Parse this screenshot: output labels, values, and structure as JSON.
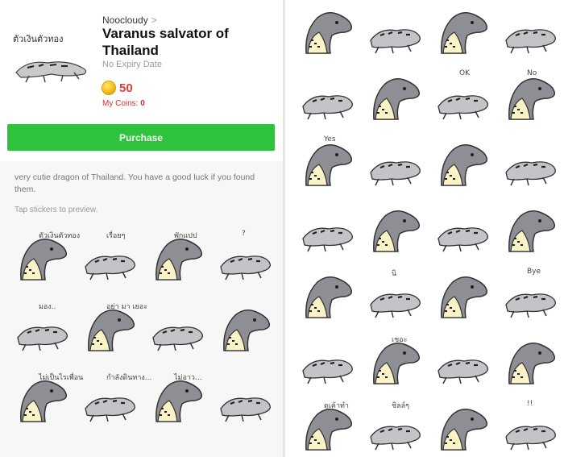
{
  "pack": {
    "author": "Noocloudy",
    "title": "Varanus salvator of Thailand",
    "expiry": "No Expiry Date",
    "price": "50",
    "my_coins_label": "My Coins:",
    "my_coins_value": "0",
    "purchase_label": "Purchase",
    "description": "very cutie dragon of Thailand. You have a good luck if you found them.",
    "hint": "Tap stickers to preview.",
    "thumb_caption": "ตัวเงินตัวทอง"
  },
  "left_stickers": [
    {
      "caption": "ตัวเงินตัวทอง"
    },
    {
      "caption": "เรื่อยๆ"
    },
    {
      "caption": "พักแปป"
    },
    {
      "caption": "?"
    },
    {
      "caption": "มอง.."
    },
    {
      "caption": "อย่า มา เยอะ"
    },
    {
      "caption": ""
    },
    {
      "caption": ""
    },
    {
      "caption": "ไม่เป็นไรเพื่อน"
    },
    {
      "caption": "กำลังดินทาง..."
    },
    {
      "caption": "ไม่อาว..."
    },
    {
      "caption": ""
    }
  ],
  "right_stickers": [
    {
      "caption": ""
    },
    {
      "caption": ""
    },
    {
      "caption": ""
    },
    {
      "caption": ""
    },
    {
      "caption": ""
    },
    {
      "caption": ""
    },
    {
      "caption": "OK"
    },
    {
      "caption": "No"
    },
    {
      "caption": "Yes"
    },
    {
      "caption": ""
    },
    {
      "caption": ""
    },
    {
      "caption": ""
    },
    {
      "caption": ""
    },
    {
      "caption": ""
    },
    {
      "caption": ""
    },
    {
      "caption": ""
    },
    {
      "caption": ""
    },
    {
      "caption": "นิ"
    },
    {
      "caption": ""
    },
    {
      "caption": "Bye"
    },
    {
      "caption": ""
    },
    {
      "caption": "เชอะ"
    },
    {
      "caption": ""
    },
    {
      "caption": ""
    },
    {
      "caption": "ดูเค้าทำ"
    },
    {
      "caption": "ชิลล์ๆ"
    },
    {
      "caption": ""
    },
    {
      "caption": "!!"
    }
  ],
  "colors": {
    "purchase": "#2fc23d",
    "price": "#e03b3b",
    "lizard_head": "#8e8e95",
    "lizard_belly": "#fbf3c8"
  }
}
